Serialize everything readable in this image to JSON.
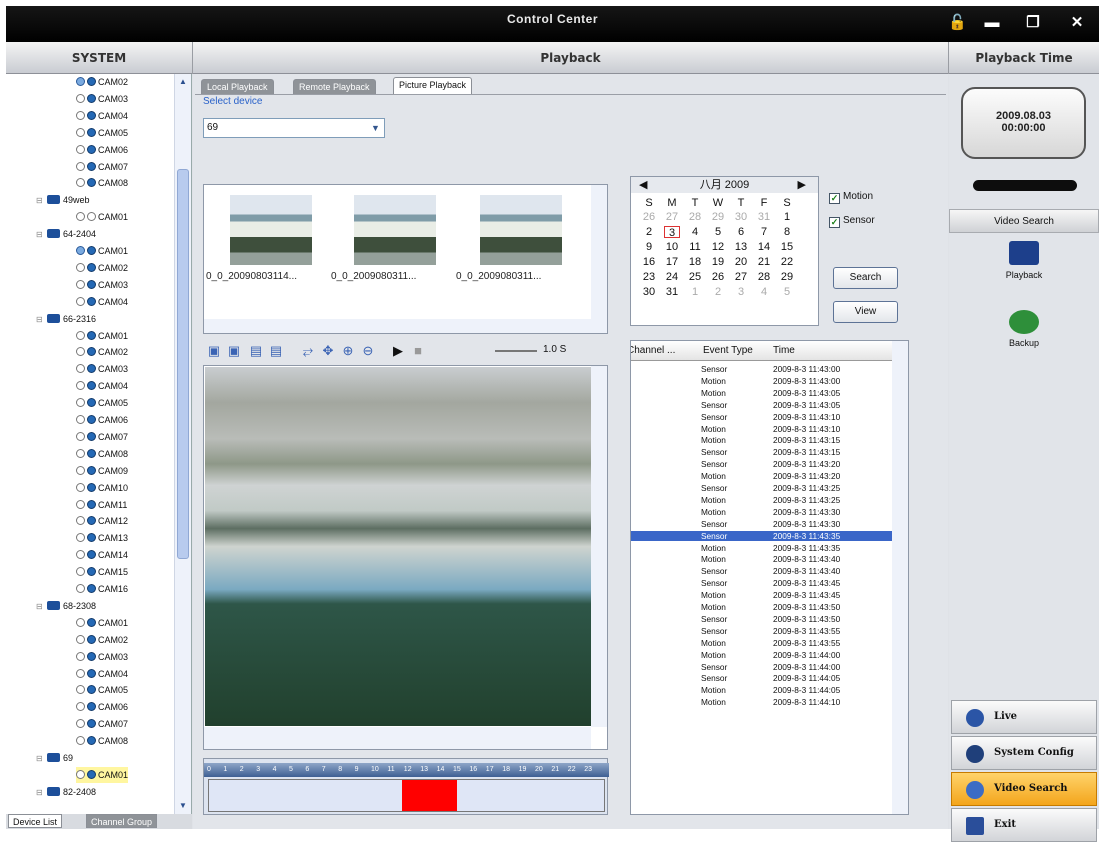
{
  "window": {
    "title": "Control Center",
    "icons": [
      "lock-icon",
      "minimize-icon",
      "restore-icon",
      "close-icon"
    ]
  },
  "headers": {
    "system": "SYSTEM",
    "playback": "Playback",
    "playback_time": "Playback Time"
  },
  "tree": [
    {
      "type": "cam",
      "label": "CAM02",
      "dots": "d3,d2"
    },
    {
      "type": "cam",
      "label": "CAM03",
      "dots": "d1,d2"
    },
    {
      "type": "cam",
      "label": "CAM04",
      "dots": "d1,d2"
    },
    {
      "type": "cam",
      "label": "CAM05",
      "dots": "d1,d2"
    },
    {
      "type": "cam",
      "label": "CAM06",
      "dots": "d1,d2"
    },
    {
      "type": "cam",
      "label": "CAM07",
      "dots": "d1,d2"
    },
    {
      "type": "cam",
      "label": "CAM08",
      "dots": "d1,d2"
    },
    {
      "type": "dev",
      "label": "49web"
    },
    {
      "type": "cam",
      "label": "CAM01",
      "dots": "d1,d1"
    },
    {
      "type": "dev",
      "label": "64-2404"
    },
    {
      "type": "cam",
      "label": "CAM01",
      "dots": "d3,d2"
    },
    {
      "type": "cam",
      "label": "CAM02",
      "dots": "d1,d2"
    },
    {
      "type": "cam",
      "label": "CAM03",
      "dots": "d1,d2"
    },
    {
      "type": "cam",
      "label": "CAM04",
      "dots": "d1,d2"
    },
    {
      "type": "dev",
      "label": "66-2316"
    },
    {
      "type": "cam",
      "label": "CAM01",
      "dots": "d1,d2"
    },
    {
      "type": "cam",
      "label": "CAM02",
      "dots": "d1,d2"
    },
    {
      "type": "cam",
      "label": "CAM03",
      "dots": "d1,d2"
    },
    {
      "type": "cam",
      "label": "CAM04",
      "dots": "d1,d2"
    },
    {
      "type": "cam",
      "label": "CAM05",
      "dots": "d1,d2"
    },
    {
      "type": "cam",
      "label": "CAM06",
      "dots": "d1,d2"
    },
    {
      "type": "cam",
      "label": "CAM07",
      "dots": "d1,d2"
    },
    {
      "type": "cam",
      "label": "CAM08",
      "dots": "d1,d2"
    },
    {
      "type": "cam",
      "label": "CAM09",
      "dots": "d1,d2"
    },
    {
      "type": "cam",
      "label": "CAM10",
      "dots": "d1,d2"
    },
    {
      "type": "cam",
      "label": "CAM11",
      "dots": "d1,d2"
    },
    {
      "type": "cam",
      "label": "CAM12",
      "dots": "d1,d2"
    },
    {
      "type": "cam",
      "label": "CAM13",
      "dots": "d1,d2"
    },
    {
      "type": "cam",
      "label": "CAM14",
      "dots": "d1,d2"
    },
    {
      "type": "cam",
      "label": "CAM15",
      "dots": "d1,d2"
    },
    {
      "type": "cam",
      "label": "CAM16",
      "dots": "d1,d2"
    },
    {
      "type": "dev",
      "label": "68-2308"
    },
    {
      "type": "cam",
      "label": "CAM01",
      "dots": "d1,d2"
    },
    {
      "type": "cam",
      "label": "CAM02",
      "dots": "d1,d2"
    },
    {
      "type": "cam",
      "label": "CAM03",
      "dots": "d1,d2"
    },
    {
      "type": "cam",
      "label": "CAM04",
      "dots": "d1,d2"
    },
    {
      "type": "cam",
      "label": "CAM05",
      "dots": "d1,d2"
    },
    {
      "type": "cam",
      "label": "CAM06",
      "dots": "d1,d2"
    },
    {
      "type": "cam",
      "label": "CAM07",
      "dots": "d1,d2"
    },
    {
      "type": "cam",
      "label": "CAM08",
      "dots": "d1,d2"
    },
    {
      "type": "dev",
      "label": "69"
    },
    {
      "type": "cam",
      "label": "CAM01",
      "dots": "d1,d2",
      "selected": true
    },
    {
      "type": "dev",
      "label": "82-2408"
    }
  ],
  "left_tabs": {
    "device_list": "Device List",
    "channel_group": "Channel Group"
  },
  "tabs": {
    "local": "Local Playback",
    "remote": "Remote Playback",
    "picture": "Picture Playback"
  },
  "select_device": {
    "label": "Select device",
    "value": "69"
  },
  "pictures": [
    "0_0_20090803114...",
    "0_0_2009080311...",
    "0_0_2009080311..."
  ],
  "toolbar": {
    "speed": "1.0 S"
  },
  "timeline_hours": [
    "0",
    "1",
    "2",
    "3",
    "4",
    "5",
    "6",
    "7",
    "8",
    "9",
    "10",
    "11",
    "12",
    "13",
    "14",
    "15",
    "16",
    "17",
    "18",
    "19",
    "20",
    "21",
    "22",
    "23"
  ],
  "calendar": {
    "title": "八月 2009",
    "weekdays": [
      "S",
      "M",
      "T",
      "W",
      "T",
      "F",
      "S"
    ],
    "rows": [
      [
        "26",
        "27",
        "28",
        "29",
        "30",
        "31",
        "1"
      ],
      [
        "2",
        "3",
        "4",
        "5",
        "6",
        "7",
        "8"
      ],
      [
        "9",
        "10",
        "11",
        "12",
        "13",
        "14",
        "15"
      ],
      [
        "16",
        "17",
        "18",
        "19",
        "20",
        "21",
        "22"
      ],
      [
        "23",
        "24",
        "25",
        "26",
        "27",
        "28",
        "29"
      ],
      [
        "30",
        "31",
        "1",
        "2",
        "3",
        "4",
        "5"
      ]
    ]
  },
  "checks": {
    "motion": "Motion",
    "sensor": "Sensor"
  },
  "buttons": {
    "search": "Search",
    "view": "View"
  },
  "events": {
    "headers": {
      "channel": "Channel ...",
      "event": "Event Type",
      "time": "Time"
    },
    "rows": [
      [
        "Sensor",
        "2009-8-3 11:43:00"
      ],
      [
        "Motion",
        "2009-8-3 11:43:00"
      ],
      [
        "Motion",
        "2009-8-3 11:43:05"
      ],
      [
        "Sensor",
        "2009-8-3 11:43:05"
      ],
      [
        "Sensor",
        "2009-8-3 11:43:10"
      ],
      [
        "Motion",
        "2009-8-3 11:43:10"
      ],
      [
        "Motion",
        "2009-8-3 11:43:15"
      ],
      [
        "Sensor",
        "2009-8-3 11:43:15"
      ],
      [
        "Sensor",
        "2009-8-3 11:43:20"
      ],
      [
        "Motion",
        "2009-8-3 11:43:20"
      ],
      [
        "Sensor",
        "2009-8-3 11:43:25"
      ],
      [
        "Motion",
        "2009-8-3 11:43:25"
      ],
      [
        "Motion",
        "2009-8-3 11:43:30"
      ],
      [
        "Sensor",
        "2009-8-3 11:43:30"
      ],
      [
        "Sensor",
        "2009-8-3 11:43:35"
      ],
      [
        "Motion",
        "2009-8-3 11:43:35"
      ],
      [
        "Motion",
        "2009-8-3 11:43:40"
      ],
      [
        "Sensor",
        "2009-8-3 11:43:40"
      ],
      [
        "Sensor",
        "2009-8-3 11:43:45"
      ],
      [
        "Motion",
        "2009-8-3 11:43:45"
      ],
      [
        "Motion",
        "2009-8-3 11:43:50"
      ],
      [
        "Sensor",
        "2009-8-3 11:43:50"
      ],
      [
        "Sensor",
        "2009-8-3 11:43:55"
      ],
      [
        "Motion",
        "2009-8-3 11:43:55"
      ],
      [
        "Motion",
        "2009-8-3 11:44:00"
      ],
      [
        "Sensor",
        "2009-8-3 11:44:00"
      ],
      [
        "Sensor",
        "2009-8-3 11:44:05"
      ],
      [
        "Motion",
        "2009-8-3 11:44:05"
      ],
      [
        "Motion",
        "2009-8-3 11:44:10"
      ]
    ],
    "selected_index": 14
  },
  "playback_time": {
    "date": "2009.08.03",
    "time": "00:00:00"
  },
  "video_search": {
    "header": "Video Search",
    "playback": "Playback",
    "backup": "Backup"
  },
  "nav": {
    "live": "Live",
    "system_config": "System Config",
    "video_search": "Video Search",
    "exit": "Exit"
  }
}
